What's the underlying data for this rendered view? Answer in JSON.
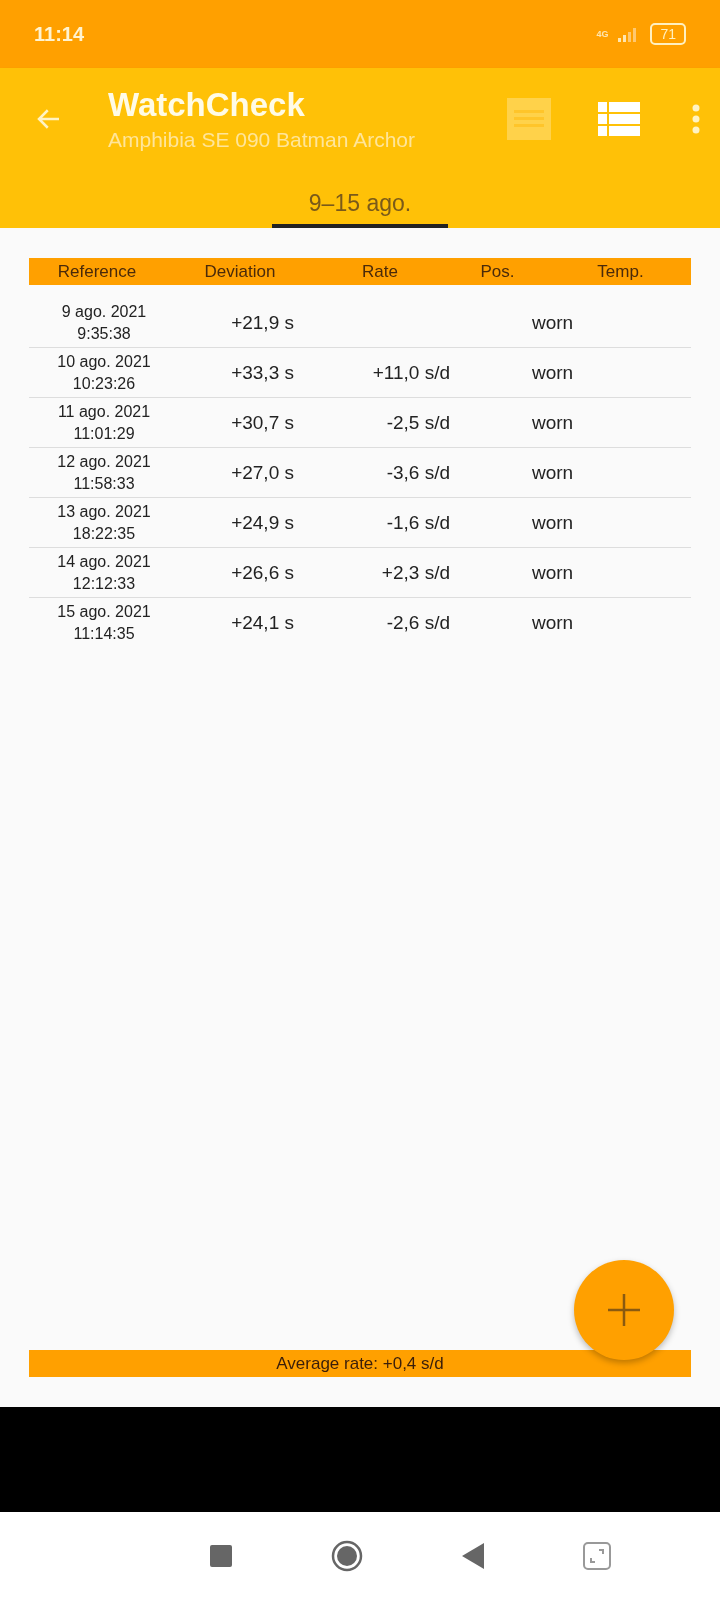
{
  "status_bar": {
    "time": "11:14",
    "network": "4G",
    "battery": "71"
  },
  "app_bar": {
    "title": "WatchCheck",
    "subtitle": "Amphibia SE 090 Batman Archor"
  },
  "tabs": [
    {
      "label": "9–15 ago.",
      "selected": true
    }
  ],
  "table": {
    "columns": [
      "Reference",
      "Deviation",
      "Rate",
      "Pos.",
      "Temp."
    ],
    "rows": [
      {
        "date": "9 ago. 2021",
        "time": "9:35:38",
        "deviation": "+21,9 s",
        "position": "worn"
      },
      {
        "date": "10 ago. 2021",
        "time": "10:23:26",
        "deviation": "+33,3 s",
        "rate": "+11,0 s/d",
        "position": "worn"
      },
      {
        "date": "11 ago. 2021",
        "time": "11:01:29",
        "deviation": "+30,7 s",
        "rate": "-2,5 s/d",
        "position": "worn"
      },
      {
        "date": "12 ago. 2021",
        "time": "11:58:33",
        "deviation": "+27,0 s",
        "rate": "-3,6 s/d",
        "position": "worn"
      },
      {
        "date": "13 ago. 2021",
        "time": "18:22:35",
        "deviation": "+24,9 s",
        "rate": "-1,6 s/d",
        "position": "worn"
      },
      {
        "date": "14 ago. 2021",
        "time": "12:12:33",
        "deviation": "+26,6 s",
        "rate": "+2,3 s/d",
        "position": "worn"
      },
      {
        "date": "15 ago. 2021",
        "time": "11:14:35",
        "deviation": "+24,1 s",
        "rate": "-2,6 s/d",
        "position": "worn"
      }
    ]
  },
  "average": "Average rate: +0,4 s/d"
}
